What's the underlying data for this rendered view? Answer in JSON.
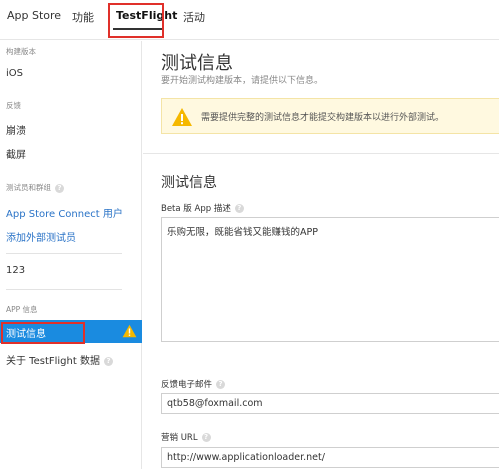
{
  "topnav": {
    "items": [
      "App Store",
      "功能",
      "TestFlight",
      "活动"
    ],
    "active": "TestFlight"
  },
  "sidebar": {
    "build_header": "构建版本",
    "build_items": [
      "iOS"
    ],
    "feedback_header": "反馈",
    "feedback_items": [
      "崩溃",
      "截屏"
    ],
    "testers_header": "测试员和群组",
    "testers_items": [
      "App Store Connect 用户",
      "添加外部测试员"
    ],
    "group_items": [
      "123"
    ],
    "app_info_header": "APP 信息",
    "app_info_items": [
      "测试信息",
      "关于 TestFlight 数据"
    ],
    "active_item": "测试信息",
    "help_glyph": "?"
  },
  "main": {
    "title": "测试信息",
    "subtitle": "要开始测试构建版本，请提供以下信息。",
    "warning_text": "需要提供完整的测试信息才能提交构建版本以进行外部测试。",
    "section_title": "测试信息",
    "beta_desc_label": "Beta 版 App 描述",
    "beta_desc_value": "乐购无限，既能省钱又能赚钱的APP",
    "feedback_email_label": "反馈电子邮件",
    "feedback_email_value": "qtb58@foxmail.com",
    "marketing_url_label": "营销 URL",
    "marketing_url_value": "http://www.applicationloader.net/"
  },
  "colors": {
    "accent": "#1a8be0",
    "link": "#2a73c7",
    "warning": "#f5b800",
    "highlight_box": "#e0302a"
  }
}
